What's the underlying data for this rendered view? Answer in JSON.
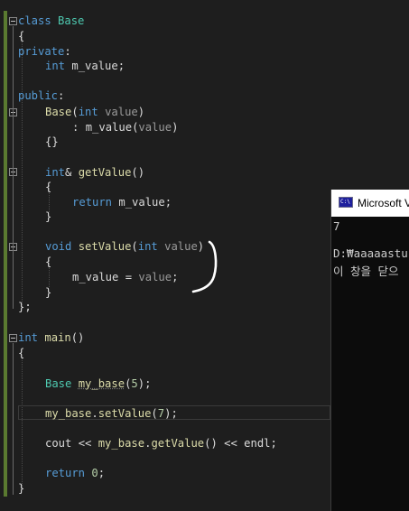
{
  "editor": {
    "lines": {
      "l1": {
        "kw": "class",
        "name": "Base"
      },
      "l2": {
        "text": "{"
      },
      "l3": {
        "kw": "private",
        "colon": ":"
      },
      "l4": {
        "ty": "int",
        "mem": "m_value",
        "end": ";"
      },
      "l6": {
        "kw": "public",
        "colon": ":"
      },
      "l7": {
        "fn": "Base",
        "open": "(",
        "ty": "int",
        "par": "value",
        "close": ")"
      },
      "l8": {
        "colon": ": ",
        "mem": "m_value",
        "open": "(",
        "par": "value",
        "close": ")"
      },
      "l9": {
        "text": "{}"
      },
      "l11": {
        "ty": "int",
        "amp": "& ",
        "fn": "getValue",
        "rest": "()"
      },
      "l12": {
        "text": "{"
      },
      "l13": {
        "kw": "return",
        "mem": "m_value",
        "end": ";"
      },
      "l14": {
        "text": "}"
      },
      "l16": {
        "ty": "void",
        "fn": "setValue",
        "open": "(",
        "ty2": "int",
        "par": "value",
        "close": ")"
      },
      "l17": {
        "text": "{"
      },
      "l18": {
        "mem": "m_value",
        "op": " = ",
        "par": "value",
        "end": ";"
      },
      "l19": {
        "text": "}"
      },
      "l20": {
        "text": "};"
      },
      "l22": {
        "ty": "int",
        "fn": "main",
        "rest": "()"
      },
      "l23": {
        "text": "{"
      },
      "l25": {
        "ty": "Base",
        "var": "my_base",
        "open": "(",
        "num": "5",
        "close": ");"
      },
      "l27": {
        "var": "my_base",
        "dot": ".",
        "fn": "setValue",
        "open": "(",
        "num": "7",
        "close": ");"
      },
      "l29": {
        "cout": "cout",
        "op1": " << ",
        "var": "my_base",
        "dot": ".",
        "fn": "getValue",
        "mid": "() << ",
        "endl": "endl",
        "end": ";"
      },
      "l31": {
        "kw": "return",
        "num": "0",
        "end": ";"
      },
      "l32": {
        "text": "}"
      }
    }
  },
  "console": {
    "title": "Microsoft V",
    "icon_label": "C:\\",
    "output_value": "7",
    "path_text": "D:₩aaaaastu",
    "close_hint": "이 창을 닫으"
  },
  "colors": {
    "background": "#1e1e1e",
    "keyword": "#569cd6",
    "type": "#4ec9b0",
    "function": "#dcdcaa",
    "parameter": "#9a9a9a",
    "number": "#b5cea8",
    "console_bg": "#0c0c0c"
  }
}
